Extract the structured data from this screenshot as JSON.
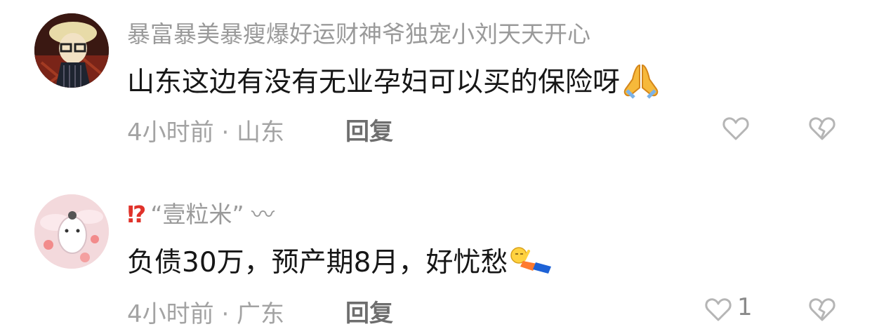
{
  "comments": [
    {
      "username": "暴富暴美暴瘦爆好运财神爷独宠小刘天天开心",
      "text": "山东这边有没有无业孕妇可以买的保险呀",
      "emoji": "pray-emoji",
      "meta": "4小时前 · 山东",
      "reply_label": "回复",
      "like_count": ""
    },
    {
      "username_prefix": "⁉",
      "username": "“壹粒米” 〰",
      "text": "负债30万，预产期8月，好忧愁",
      "emoji": "lying-down-emoji",
      "meta": "4小时前 · 广东",
      "reply_label": "回复",
      "like_count": "1"
    }
  ],
  "icons": {
    "like": "heart-outline-icon",
    "dislike": "broken-heart-icon"
  },
  "colors": {
    "username": "#9a9a9a",
    "content": "#161616",
    "meta": "#a3a3a3"
  }
}
